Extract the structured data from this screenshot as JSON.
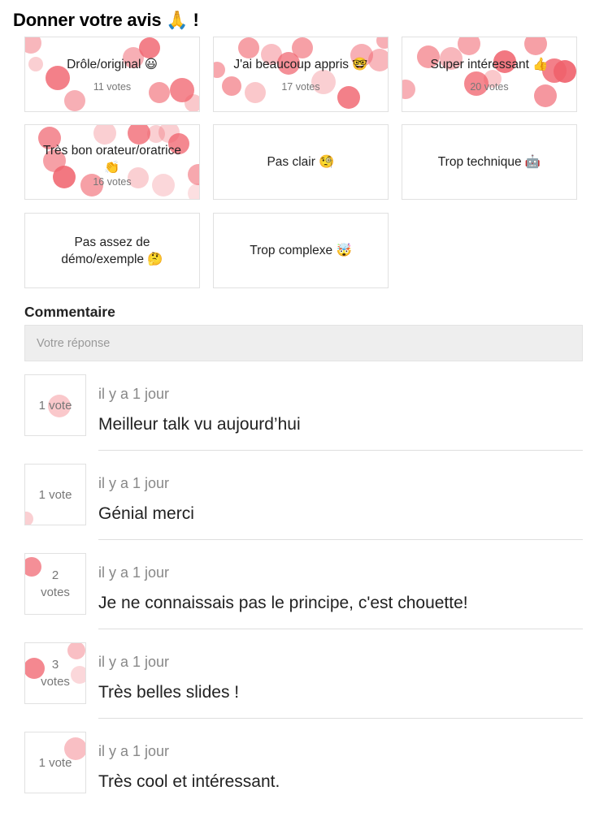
{
  "page": {
    "title": "Donner votre avis 🙏 !"
  },
  "colors": {
    "bubble": "#f0606b",
    "border": "#e1e1e1",
    "input_bg": "#eeeeee"
  },
  "feedback_options": [
    {
      "label": "Drôle/original 😃",
      "votes": "11 votes"
    },
    {
      "label": "J'ai beaucoup appris 🤓",
      "votes": "17 votes"
    },
    {
      "label": "Super intéressant 👍",
      "votes": "20 votes"
    },
    {
      "label": "Très bon orateur/oratrice 👏",
      "votes": "16 votes"
    },
    {
      "label": "Pas clair 🧐",
      "votes": ""
    },
    {
      "label": "Trop technique 🤖",
      "votes": ""
    },
    {
      "label": "Pas assez de démo/exemple 🤔",
      "votes": ""
    },
    {
      "label": "Trop complexe 🤯",
      "votes": ""
    }
  ],
  "comment_section": {
    "title": "Commentaire",
    "placeholder": "Votre réponse"
  },
  "comments": [
    {
      "votes": "1 vote",
      "time": "il y a 1 jour",
      "text": "Meilleur talk vu aujourd’hui"
    },
    {
      "votes": "1 vote",
      "time": "il y a 1 jour",
      "text": "Génial merci"
    },
    {
      "votes": "2 votes",
      "time": "il y a 1 jour",
      "text": "Je ne connaissais pas le principe, c'est chouette!"
    },
    {
      "votes": "3 votes",
      "time": "il y a 1 jour",
      "text": "Très belles slides !"
    },
    {
      "votes": "1 vote",
      "time": "il y a 1 jour",
      "text": "Très cool et intéressant."
    }
  ]
}
